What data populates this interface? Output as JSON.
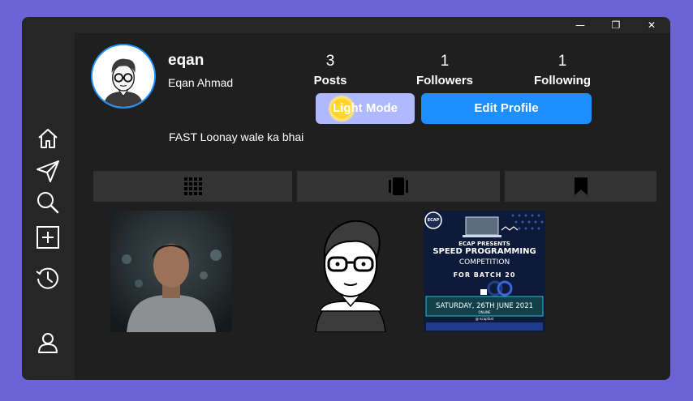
{
  "window_controls": {
    "minimize": "—",
    "maximize": "❐",
    "close": "✕"
  },
  "sidebar": {
    "items": [
      {
        "name": "home",
        "icon": "home-icon"
      },
      {
        "name": "messages",
        "icon": "paper-plane-icon"
      },
      {
        "name": "search",
        "icon": "search-icon"
      },
      {
        "name": "new-post",
        "icon": "plus-square-icon"
      },
      {
        "name": "history",
        "icon": "history-icon"
      },
      {
        "name": "profile",
        "icon": "user-icon"
      }
    ]
  },
  "profile": {
    "username": "eqan",
    "full_name": "Eqan Ahmad",
    "bio": "FAST Loonay wale ka bhai",
    "stats": {
      "posts": {
        "value": "3",
        "label": "Posts"
      },
      "followers": {
        "value": "1",
        "label": "Followers"
      },
      "following": {
        "value": "1",
        "label": "Following"
      }
    }
  },
  "buttons": {
    "light_mode": "Light Mode",
    "edit_profile": "Edit Profile"
  },
  "tabs": [
    {
      "name": "grid",
      "icon": "grid-icon"
    },
    {
      "name": "reels",
      "icon": "carousel-icon"
    },
    {
      "name": "saved",
      "icon": "bookmark-icon"
    }
  ],
  "poster": {
    "brand": "ECAP",
    "presents": "ECAP PRESENTS",
    "title": "SPEED PROGRAMMING",
    "subtitle": "COMPETITION",
    "batch": "FOR BATCH 20",
    "date": "SATURDAY, 26TH JUNE 2021",
    "mode": "ONLINE",
    "handle": "@ ecapfast"
  },
  "colors": {
    "accent": "#1e8fff",
    "light_button": "#aeb9ff",
    "background": "#1f1f1f",
    "sidebar": "#262626",
    "frame": "#6b63d6"
  }
}
